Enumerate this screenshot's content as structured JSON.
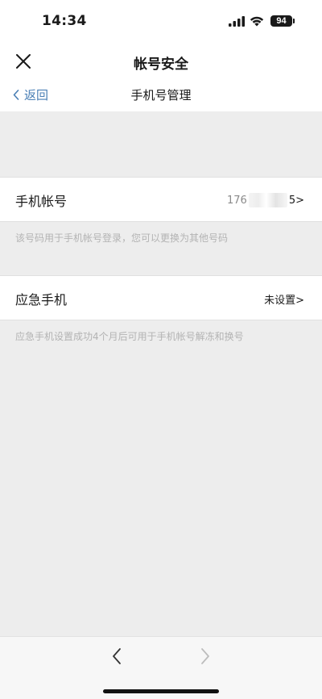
{
  "status_bar": {
    "time": "14:34",
    "battery": "94"
  },
  "title_bar": {
    "title": "帐号安全"
  },
  "sub_header": {
    "back_label": "返回",
    "title": "手机号管理"
  },
  "phone_row": {
    "label": "手机帐号",
    "value_prefix": "176",
    "value_suffix": "5>"
  },
  "phone_hint": "该号码用于手机帐号登录，您可以更换为其他号码",
  "emergency_row": {
    "label": "应急手机",
    "value": "未设置>"
  },
  "emergency_hint": "应急手机设置成功4个月后可用于手机帐号解冻和换号"
}
